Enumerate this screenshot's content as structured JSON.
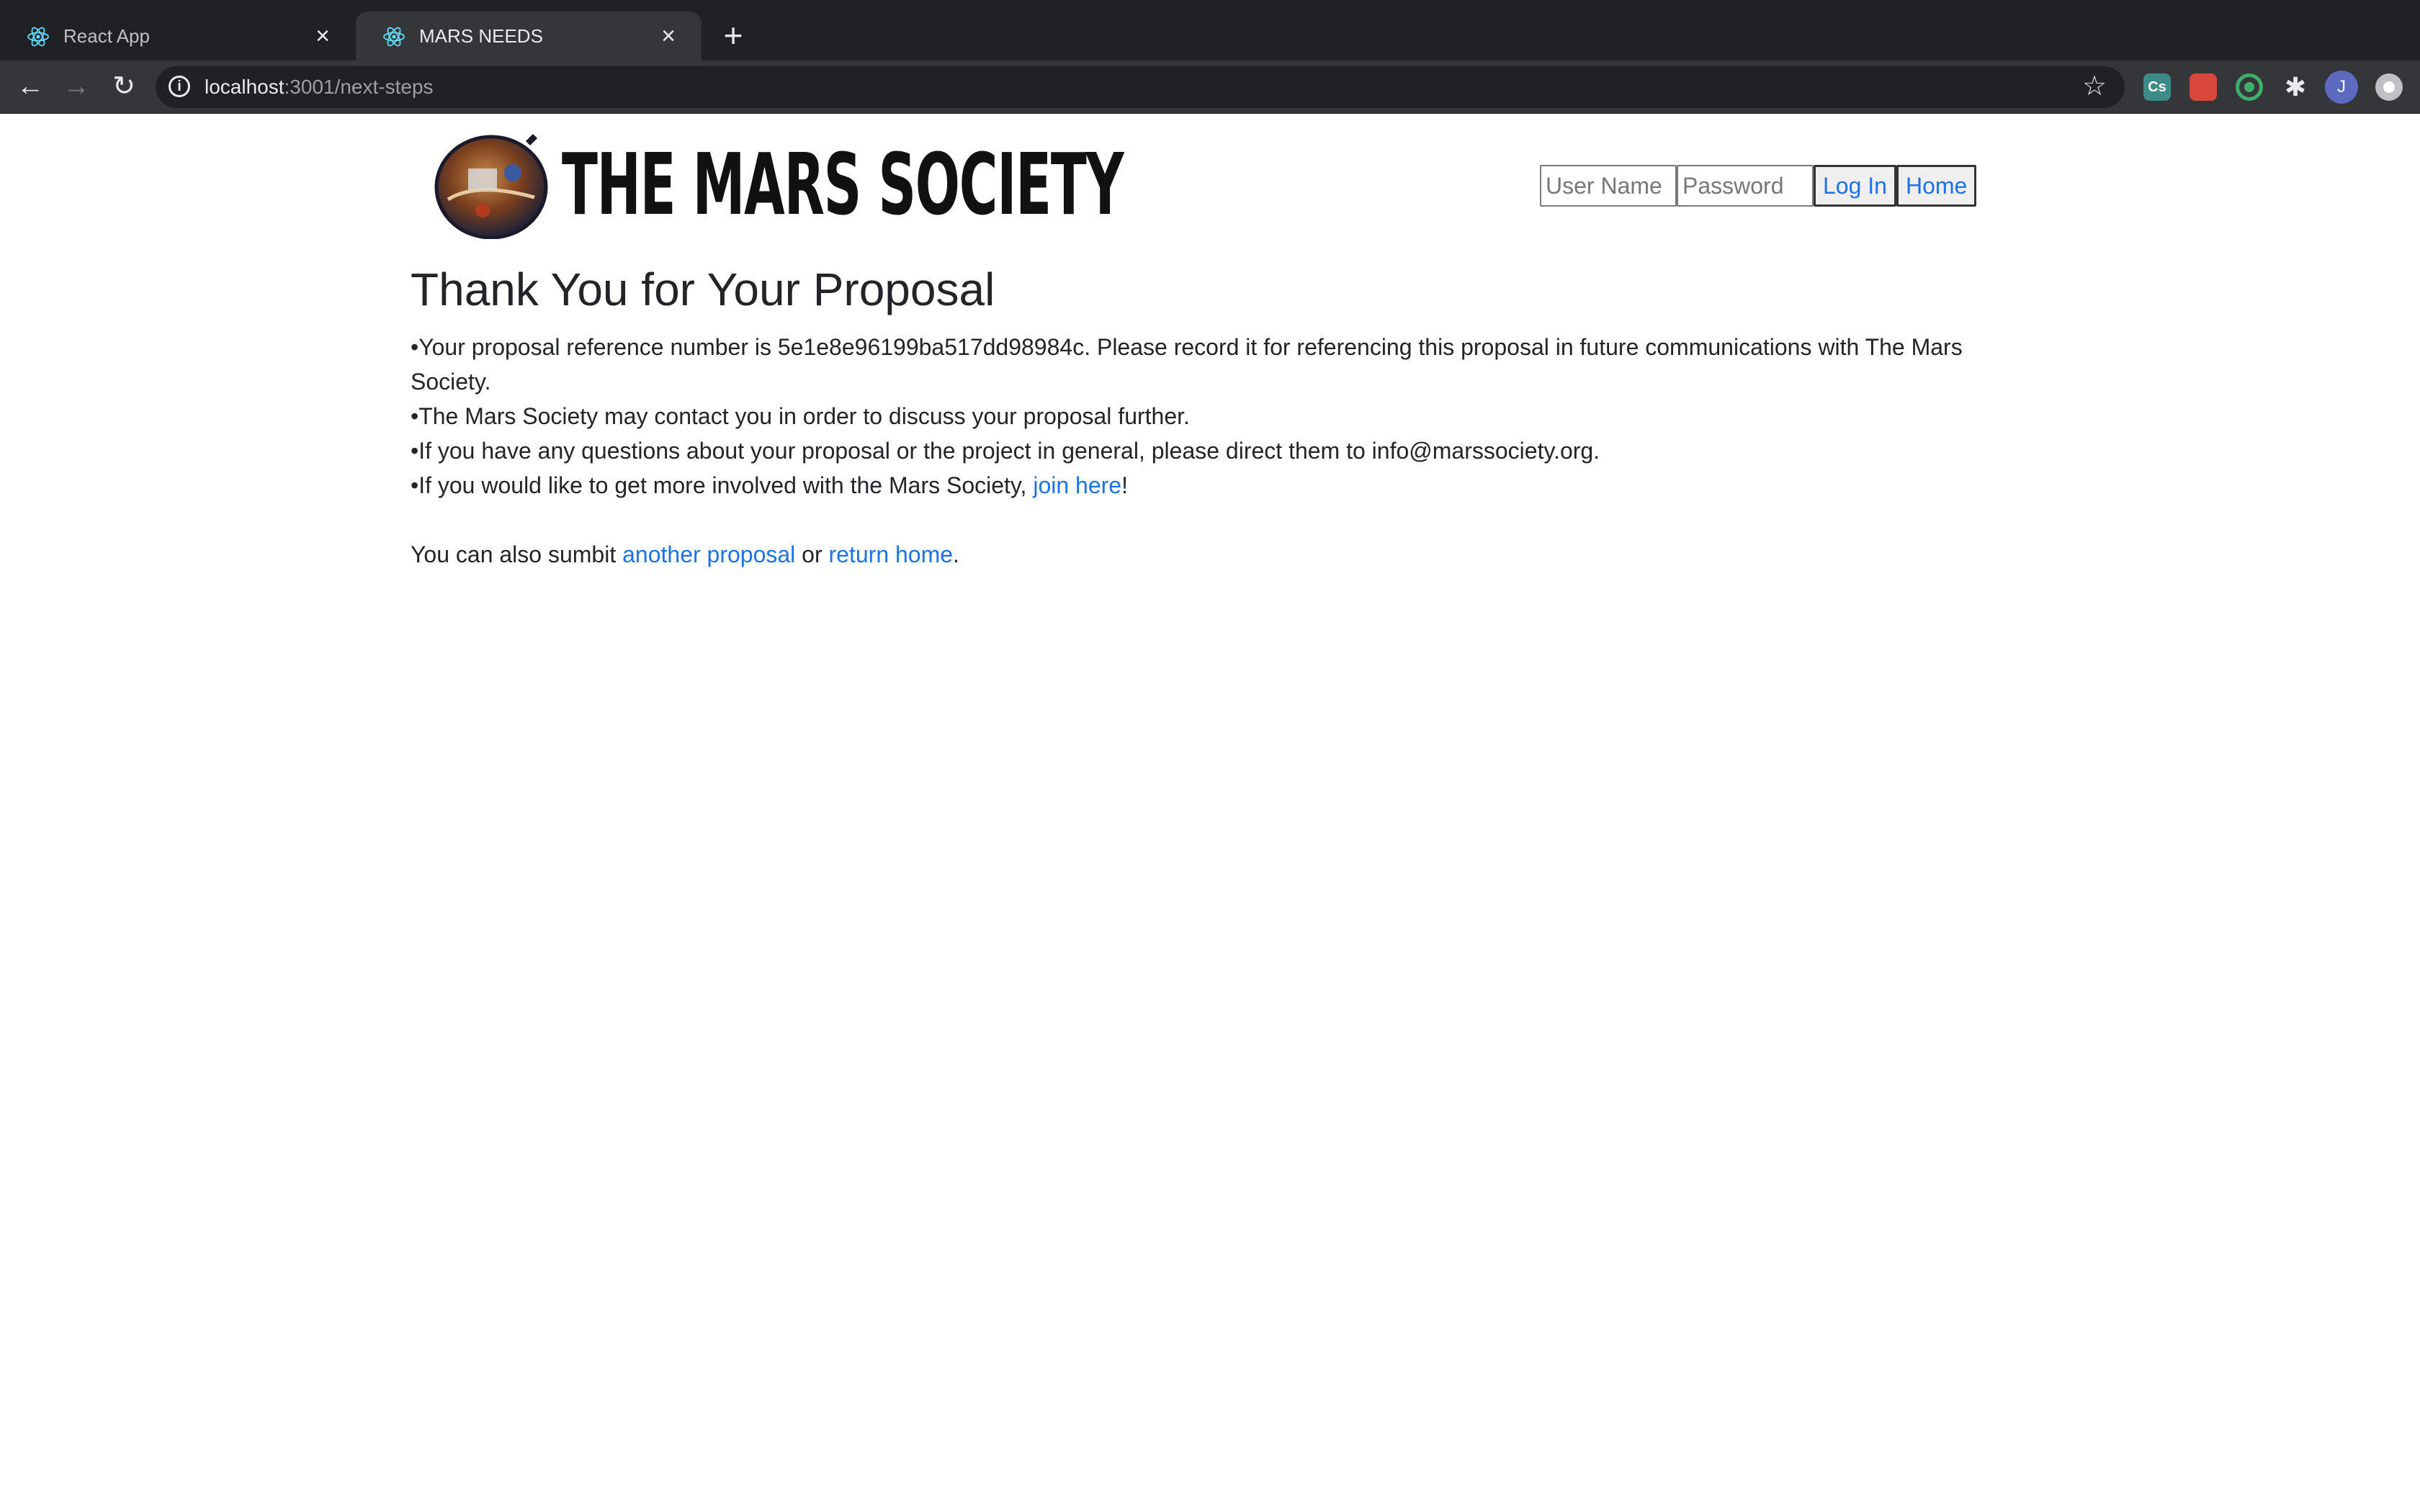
{
  "browser": {
    "tabs": [
      {
        "title": "React App",
        "active": false
      },
      {
        "title": "MARS NEEDS",
        "active": true
      }
    ],
    "url_host": "localhost",
    "url_path": ":3001/next-steps",
    "avatar_letter": "J",
    "extension_label": "Cs"
  },
  "header": {
    "logo_text": "THE MARS SOCIETY",
    "username_placeholder": "User Name",
    "password_placeholder": "Password",
    "login_label": "Log In",
    "home_label": "Home"
  },
  "main": {
    "heading": "Thank You for Your Proposal",
    "line1": "•Your proposal reference number is 5e1e8e96199ba517dd98984c. Please record it for referencing this proposal in future communications with The Mars Society.",
    "line2": "•The Mars Society may contact you in order to discuss your proposal further.",
    "line3": "•If you have any questions about your proposal or the project in general, please direct them to info@marssociety.org.",
    "line4_prefix": "•If you would like to get more involved with the Mars Society, ",
    "line4_link": "join here",
    "line4_suffix": "!",
    "footer_prefix": "You can also sumbit ",
    "footer_link1": "another proposal",
    "footer_middle": " or ",
    "footer_link2": "return home",
    "footer_suffix": "."
  },
  "colors": {
    "link": "#1a73e8",
    "text": "#212529",
    "chrome_dark": "#202124",
    "chrome_toolbar": "#35363a"
  }
}
